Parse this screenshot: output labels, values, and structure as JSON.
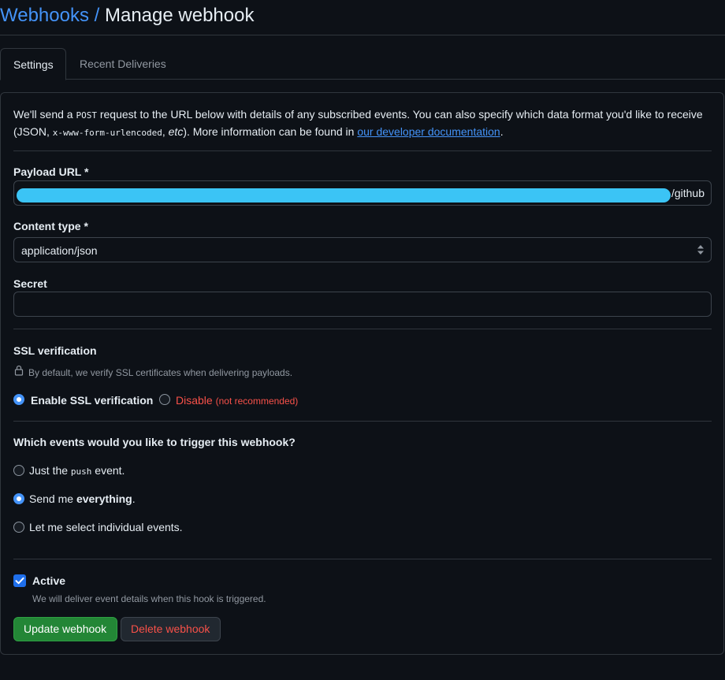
{
  "breadcrumb": {
    "parent": "Webhooks",
    "separator": "/",
    "current": "Manage webhook"
  },
  "tabs": [
    {
      "label": "Settings",
      "selected": true
    },
    {
      "label": "Recent Deliveries",
      "selected": false
    }
  ],
  "intro": {
    "part1": "We'll send a ",
    "method": "POST",
    "part2": " request to the URL below with details of any subscribed events. You can also specify which data format you'd like to receive (JSON, ",
    "format": "x-www-form-urlencoded",
    "part3": ", ",
    "etc": "etc",
    "part4": "). More information can be found in ",
    "link": "our developer documentation",
    "part5": "."
  },
  "payload_url": {
    "label": "Payload URL *",
    "value_suffix": "/github"
  },
  "content_type": {
    "label": "Content type *",
    "value": "application/json"
  },
  "secret": {
    "label": "Secret",
    "value": ""
  },
  "ssl": {
    "label": "SSL verification",
    "hint": "By default, we verify SSL certificates when delivering payloads.",
    "enable_label": "Enable SSL verification",
    "disable_label": "Disable",
    "disable_note": "(not recommended)",
    "selected": "enable"
  },
  "events": {
    "question": "Which events would you like to trigger this webhook?",
    "push_pre": "Just the ",
    "push_code": "push",
    "push_post": " event.",
    "everything_pre": "Send me ",
    "everything_bold": "everything",
    "everything_post": ".",
    "individual": "Let me select individual events.",
    "selected": "everything"
  },
  "active": {
    "label": "Active",
    "hint": "We will deliver event details when this hook is triggered.",
    "checked": true
  },
  "buttons": {
    "update": "Update webhook",
    "delete": "Delete webhook"
  },
  "colors": {
    "background": "#0d1117",
    "link": "#4493f8",
    "border": "#30363d",
    "primary_button": "#238636",
    "danger": "#f85149",
    "redaction": "#3bc4f5"
  }
}
